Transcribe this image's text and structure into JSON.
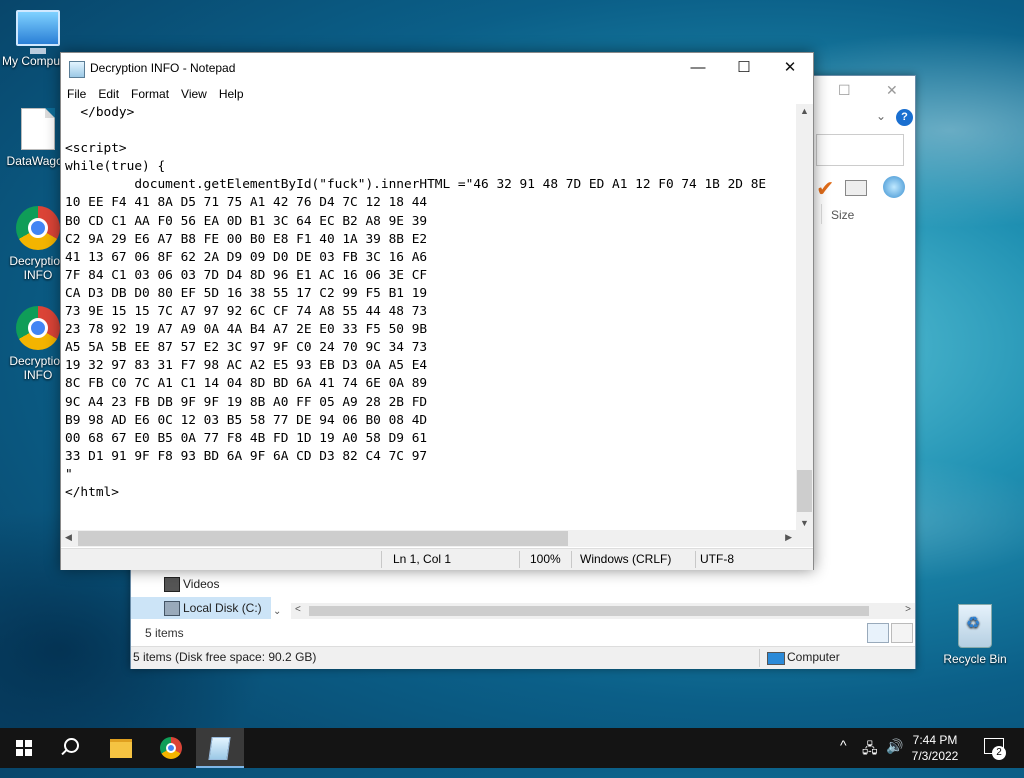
{
  "desktop": {
    "icons": [
      {
        "label": "My Computer"
      },
      {
        "label": "DataWagon"
      },
      {
        "label": "Decryption INFO"
      },
      {
        "label": "Decryption INFO"
      },
      {
        "label": "Recycle Bin"
      }
    ]
  },
  "explorer": {
    "column_size": "Size",
    "nav_items": [
      {
        "label": "Videos",
        "icon": "videos-icon"
      },
      {
        "label": "Local Disk (C:)",
        "icon": "disk-icon"
      }
    ],
    "item_count": "5 items",
    "status_left": "5 items (Disk free space: 90.2 GB)",
    "status_right": "Computer"
  },
  "notepad": {
    "title": "Decryption INFO - Notepad",
    "menu": [
      "File",
      "Edit",
      "Format",
      "View",
      "Help"
    ],
    "content": "  </body>\n\n<script>\nwhile(true) {\n         document.getElementById(\"fuck\").innerHTML =\"46 32 91 48 7D ED A1 12 F0 74 1B 2D 8E\n10 EE F4 41 8A D5 71 75 A1 42 76 D4 7C 12 18 44\nB0 CD C1 AA F0 56 EA 0D B1 3C 64 EC B2 A8 9E 39\nC2 9A 29 E6 A7 B8 FE 00 B0 E8 F1 40 1A 39 8B E2\n41 13 67 06 8F 62 2A D9 09 D0 DE 03 FB 3C 16 A6\n7F 84 C1 03 06 03 7D D4 8D 96 E1 AC 16 06 3E CF\nCA D3 DB D0 80 EF 5D 16 38 55 17 C2 99 F5 B1 19\n73 9E 15 15 7C A7 97 92 6C CF 74 A8 55 44 48 73\n23 78 92 19 A7 A9 0A 4A B4 A7 2E E0 33 F5 50 9B\nA5 5A 5B EE 87 57 E2 3C 97 9F C0 24 70 9C 34 73\n19 32 97 83 31 F7 98 AC A2 E5 93 EB D3 0A A5 E4\n8C FB C0 7C A1 C1 14 04 8D BD 6A 41 74 6E 0A 89\n9C A4 23 FB DB 9F 9F 19 8B A0 FF 05 A9 28 2B FD\nB9 98 AD E6 0C 12 03 B5 58 77 DE 94 06 B0 08 4D\n00 68 67 E0 B5 0A 77 F8 4B FD 1D 19 A0 58 D9 61\n33 D1 91 9F F8 93 BD 6A 9F 6A CD D3 82 C4 7C 97\n\"\n</html>",
    "status": {
      "position": "Ln 1, Col 1",
      "zoom": "100%",
      "line_ending": "Windows (CRLF)",
      "encoding": "UTF-8"
    },
    "controls": {
      "minimize": "—",
      "maximize": "☐",
      "close": "✕"
    }
  },
  "taskbar": {
    "apps": [
      "start",
      "search",
      "file-explorer",
      "chrome",
      "notepad"
    ],
    "clock_time": "7:44 PM",
    "clock_date": "7/3/2022",
    "notification_count": "2"
  }
}
